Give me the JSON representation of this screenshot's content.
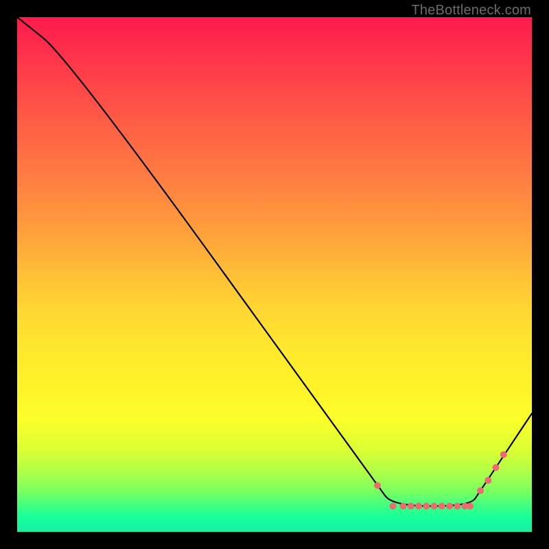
{
  "attribution": "TheBottleneck.com",
  "colors": {
    "frame_background": "#000000",
    "curve_stroke": "#000000",
    "dots_fill": "#ed6a71",
    "attribution_text": "#6b6b6b"
  },
  "chart_data": {
    "type": "line",
    "title": "",
    "xlabel": "",
    "ylabel": "",
    "xlim": [
      0,
      100
    ],
    "ylim": [
      0,
      100
    ],
    "grid": false,
    "series": [
      {
        "name": "curve",
        "x": [
          0,
          10,
          70,
          73,
          88,
          90,
          100
        ],
        "y": [
          100,
          92,
          9,
          5,
          5,
          8,
          23
        ],
        "notes": "Monotone descent from top-left with a slight knee near x≈10, reaches a flat minimum near y≈5 across roughly 73–88% of width, then rises toward the right edge."
      }
    ],
    "markers": {
      "name": "highlight-dots",
      "color": "#ed6a71",
      "x": [
        70,
        73,
        75,
        76.5,
        78,
        79.5,
        81,
        82.5,
        84,
        85.5,
        87,
        88,
        90,
        91.5,
        93,
        94.5
      ],
      "y": [
        9,
        5,
        5,
        5,
        5,
        5,
        5,
        5,
        5,
        5,
        5,
        5,
        8,
        10,
        12.5,
        15
      ]
    }
  }
}
